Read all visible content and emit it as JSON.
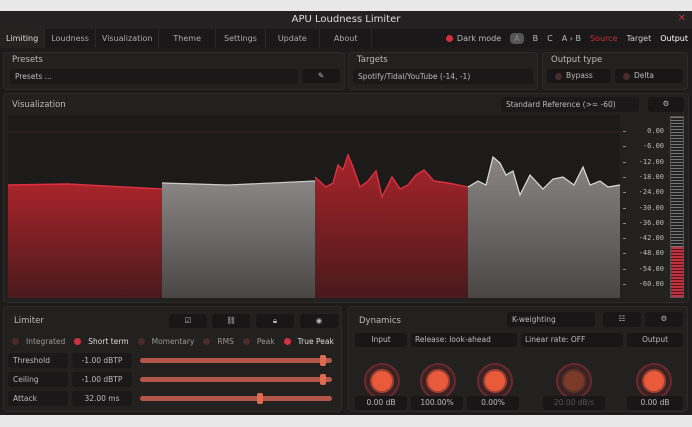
{
  "title": "APU Loudness Limiter",
  "tabs": [
    "Limiting",
    "Loudness",
    "Visualization",
    "Theme",
    "Settings",
    "Update",
    "About"
  ],
  "topbar": {
    "dark_mode": "Dark mode",
    "a": "A",
    "b": "B",
    "c": "C",
    "ab": "A › B",
    "source": "Source",
    "target": "Target",
    "output": "Output"
  },
  "presets": {
    "label": "Presets",
    "value": "Presets ..."
  },
  "targets": {
    "label": "Targets",
    "value": "Spotify/Tidal/YouTube (-14, -1)"
  },
  "output_type": {
    "label": "Output type",
    "bypass": "Bypass",
    "delta": "Delta"
  },
  "visualization": {
    "label": "Visualization",
    "reference": "Standard Reference (>= -60)",
    "scale": [
      "0.00",
      "-6.00",
      "-12.00",
      "-18.00",
      "-24.00",
      "-30.00",
      "-36.00",
      "-42.00",
      "-48.00",
      "-54.00",
      "-60.00"
    ]
  },
  "limiter": {
    "label": "Limiter",
    "modes": [
      "Integrated",
      "Short term",
      "Momentary",
      "RMS",
      "Peak",
      "True Peak"
    ],
    "params": [
      {
        "name": "Threshold",
        "value": "-1.00 dBTP",
        "fraction": 0.97
      },
      {
        "name": "Ceiling",
        "value": "-1.00 dBTP",
        "fraction": 0.97
      },
      {
        "name": "Attack",
        "value": "32.00 ms",
        "fraction": 0.63
      }
    ]
  },
  "dynamics": {
    "label": "Dynamics",
    "weighting": "K-weighting",
    "input": "Input",
    "release": "Release: look-ahead",
    "linear_rate": "Linear rate: OFF",
    "output": "Output",
    "values": [
      "0.00 dB",
      "100.00%",
      "0.00%",
      "20.00 dB/s",
      "0.00 dB"
    ]
  },
  "colors": {
    "accent": "#e85a3a",
    "red": "#d03040"
  }
}
